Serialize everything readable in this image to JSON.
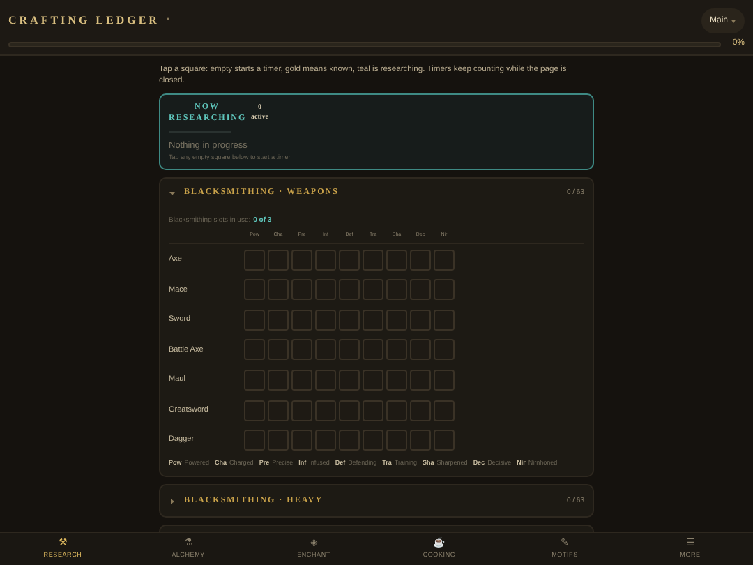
{
  "header": {
    "title": "CRAFTING LEDGER",
    "title_mark": "▪",
    "profile": "Main",
    "progress": {
      "level": 0,
      "reading": "0%"
    }
  },
  "intro": "Tap a square: empty starts a timer, gold means known, teal is researching. Timers keep counting while the page is closed.",
  "now_researching": {
    "title": "NOW RESEARCHING",
    "count": "0",
    "count_label": "active",
    "empty_title": "Nothing in progress",
    "empty_hint": "Tap any empty square below to start a timer"
  },
  "sections": [
    {
      "title": "BLACKSMITHING · WEAPONS",
      "count": "0 / 63",
      "expanded": true,
      "slots_label": "Blacksmithing slots in use:",
      "slots_value": "0 of 3",
      "columns": [
        "Pow",
        "Cha",
        "Pre",
        "Inf",
        "Def",
        "Tra",
        "Sha",
        "Dec",
        "Nir"
      ],
      "rows": [
        {
          "name": "Axe",
          "cells": [
            {
              "known": false,
              "researching": false
            },
            {
              "known": false,
              "researching": false
            },
            {
              "known": false,
              "researching": false
            },
            {
              "known": false,
              "researching": false
            },
            {
              "known": false,
              "researching": false
            },
            {
              "known": false,
              "researching": false
            },
            {
              "known": false,
              "researching": false
            },
            {
              "known": false,
              "researching": false
            },
            {
              "known": false,
              "researching": false
            }
          ]
        },
        {
          "name": "Mace",
          "cells": [
            {
              "known": false,
              "researching": false
            },
            {
              "known": false,
              "researching": false
            },
            {
              "known": false,
              "researching": false
            },
            {
              "known": false,
              "researching": false
            },
            {
              "known": false,
              "researching": false
            },
            {
              "known": false,
              "researching": false
            },
            {
              "known": false,
              "researching": false
            },
            {
              "known": false,
              "researching": false
            },
            {
              "known": false,
              "researching": false
            }
          ]
        },
        {
          "name": "Sword",
          "cells": [
            {
              "known": false,
              "researching": false
            },
            {
              "known": false,
              "researching": false
            },
            {
              "known": false,
              "researching": false
            },
            {
              "known": false,
              "researching": false
            },
            {
              "known": false,
              "researching": false
            },
            {
              "known": false,
              "researching": false
            },
            {
              "known": false,
              "researching": false
            },
            {
              "known": false,
              "researching": false
            },
            {
              "known": false,
              "researching": false
            }
          ]
        },
        {
          "name": "Battle Axe",
          "cells": [
            {
              "known": false,
              "researching": false
            },
            {
              "known": false,
              "researching": false
            },
            {
              "known": false,
              "researching": false
            },
            {
              "known": false,
              "researching": false
            },
            {
              "known": false,
              "researching": false
            },
            {
              "known": false,
              "researching": false
            },
            {
              "known": false,
              "researching": false
            },
            {
              "known": false,
              "researching": false
            },
            {
              "known": false,
              "researching": false
            }
          ]
        },
        {
          "name": "Maul",
          "cells": [
            {
              "known": false,
              "researching": false
            },
            {
              "known": false,
              "researching": false
            },
            {
              "known": false,
              "researching": false
            },
            {
              "known": false,
              "researching": false
            },
            {
              "known": false,
              "researching": false
            },
            {
              "known": false,
              "researching": false
            },
            {
              "known": false,
              "researching": false
            },
            {
              "known": false,
              "researching": false
            },
            {
              "known": false,
              "researching": false
            }
          ]
        },
        {
          "name": "Greatsword",
          "cells": [
            {
              "known": false,
              "researching": false
            },
            {
              "known": false,
              "researching": false
            },
            {
              "known": false,
              "researching": false
            },
            {
              "known": false,
              "researching": false
            },
            {
              "known": false,
              "researching": false
            },
            {
              "known": false,
              "researching": false
            },
            {
              "known": false,
              "researching": false
            },
            {
              "known": false,
              "researching": false
            },
            {
              "known": false,
              "researching": false
            }
          ]
        },
        {
          "name": "Dagger",
          "cells": [
            {
              "known": false,
              "researching": false
            },
            {
              "known": false,
              "researching": false
            },
            {
              "known": false,
              "researching": false
            },
            {
              "known": false,
              "researching": false
            },
            {
              "known": false,
              "researching": false
            },
            {
              "known": false,
              "researching": false
            },
            {
              "known": false,
              "researching": false
            },
            {
              "known": false,
              "researching": false
            },
            {
              "known": false,
              "researching": false
            }
          ]
        }
      ],
      "legend": [
        {
          "abbr": "Pow",
          "name": "Powered"
        },
        {
          "abbr": "Cha",
          "name": "Charged"
        },
        {
          "abbr": "Pre",
          "name": "Precise"
        },
        {
          "abbr": "Inf",
          "name": "Infused"
        },
        {
          "abbr": "Def",
          "name": "Defending"
        },
        {
          "abbr": "Tra",
          "name": "Training"
        },
        {
          "abbr": "Sha",
          "name": "Sharpened"
        },
        {
          "abbr": "Dec",
          "name": "Decisive"
        },
        {
          "abbr": "Nir",
          "name": "Nirnhoned"
        }
      ]
    },
    {
      "title": "BLACKSMITHING · HEAVY",
      "count": "0 / 63",
      "expanded": false
    }
  ],
  "nav": [
    {
      "icon": "⚒",
      "label": "RESEARCH",
      "selected": true
    },
    {
      "icon": "⚗",
      "label": "ALCHEMY",
      "selected": false
    },
    {
      "icon": "◈",
      "label": "ENCHANT",
      "selected": false
    },
    {
      "icon": "☕",
      "label": "COOKING",
      "selected": false
    },
    {
      "icon": "✎",
      "label": "MOTIFS",
      "selected": false
    },
    {
      "icon": "☰",
      "label": "MORE",
      "selected": false
    }
  ]
}
